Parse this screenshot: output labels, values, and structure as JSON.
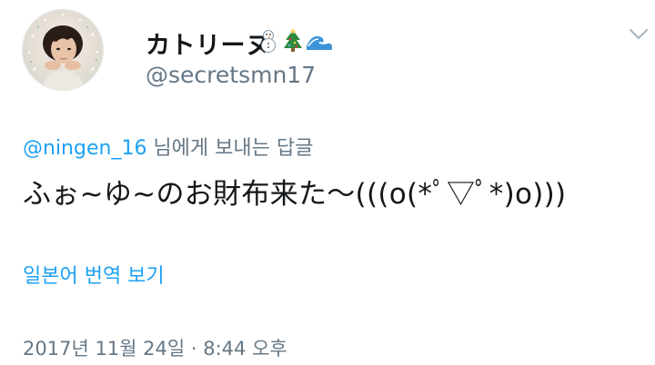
{
  "user": {
    "display_name": "カトリーヌ",
    "name_emojis": [
      "snowman-icon",
      "christmas-tree-icon",
      "wave-icon"
    ],
    "handle": "@secretsmn17"
  },
  "reply": {
    "mention": "@ningen_16",
    "context_text": " 님에게 보내는 답글"
  },
  "tweet": {
    "text": "ふぉ~ゆ~のお財布来た〜(((o(*ﾟ▽ﾟ*)o)))",
    "translate_label": "일본어 번역 보기",
    "timestamp": "2017년 11월 24일 · 8:44 오후"
  },
  "colors": {
    "link": "#1da1f2",
    "secondary_text": "#657786",
    "primary_text": "#14171a"
  }
}
